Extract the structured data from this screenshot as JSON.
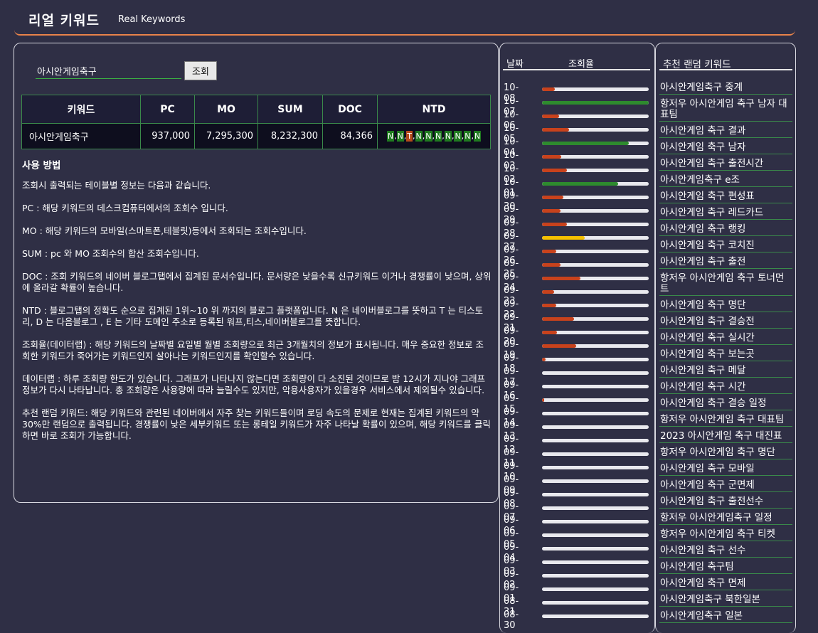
{
  "header": {
    "title": "리얼 키워드",
    "subtitle": "Real Keywords"
  },
  "search": {
    "value": "아시안게임축구",
    "button_label": "조회"
  },
  "table": {
    "headers": [
      "키워드",
      "PC",
      "MO",
      "SUM",
      "DOC",
      "NTD"
    ],
    "row": {
      "keyword": "아시안게임축구",
      "pc": "937,000",
      "mo": "7,295,300",
      "sum": "8,232,300",
      "doc": "84,366"
    },
    "ntd": [
      "N",
      "N",
      "T",
      "N",
      "N",
      "N",
      "N",
      "N",
      "N",
      "N"
    ]
  },
  "usage": {
    "title": "사용 방법",
    "paragraphs": [
      "조회시 출력되는 테이블별 정보는 다음과 같습니다.",
      "PC : 해당 키워드의 데스크컴퓨터에서의 조회수 입니다.",
      "MO : 해당 키워드의 모바일(스마트폰,테블릿)등에서 조회되는 조회수입니다.",
      "SUM : pc 와 MO 조회수의 합산 조회수입니다.",
      "DOC : 조회 키워드의 네이버 블로그탭에서 집계된 문서수입니다. 문서량은 낮을수록 신규키워드 이거나 경쟁률이 낮으며, 상위에 올라갈 확률이 높습니다.",
      "NTD : 블로그탭의 정확도 순으로 집계된 1위~10 위 까지의 블로그 플랫폼입니다. N 은 네이버블로그를 뜻하고 T 는 티스토리, D 는 다음블로그 , E 는 기타 도메인 주소로 등록된 워프,티스,네이버블로그를 뜻합니다.",
      "조회율(데이터랩) : 해당 키워드의 날짜별 요일별 월별 조회량으로 최근 3개월치의 정보가 표시됩니다. 매우 중요한 정보로 조회한 키워드가 죽어가는 키워드인지 살아나는 키워드인지를 확인할수 있습니다.",
      "데이터랩 : 하루 조회량 한도가 있습니다. 그래프가 나타나지 않는다면 조회량이 다 소진된 것이므로 밤 12시가 지나야 그래프 정보가 다시 나타납니다. 총 조회량은 사용량에 따라 늘릴수도 있지만, 악용사용자가 있을경우 서비스에서 제외될수 있습니다.",
      "추천 랜덤 키워드: 해당 키워드와 관련된 네이버에서 자주 찾는 키워드들이며 로딩 속도의 문제로 현재는 집계된 키워드의 약 30%만 랜덤으로 출력됩니다. 경쟁률이 낮은 세부키워드 또는 롱테일 키워드가 자주 나타날 확률이 있으며, 해당 키워드를 클릭하면 바로 조회가 가능합니다."
    ]
  },
  "trend": {
    "date_label": "날짜",
    "rate_label": "조회율",
    "colors": {
      "low": "#c8421c",
      "high": "#2e8b2e",
      "mid": "#f5c000",
      "track": "#e9e9ee"
    },
    "rows": [
      {
        "date": "10-08",
        "value": 12,
        "color": "low"
      },
      {
        "date": "10-07",
        "value": 100,
        "color": "high"
      },
      {
        "date": "10-06",
        "value": 16,
        "color": "low"
      },
      {
        "date": "10-05",
        "value": 25,
        "color": "low"
      },
      {
        "date": "10-04",
        "value": 81,
        "color": "high"
      },
      {
        "date": "10-03",
        "value": 18,
        "color": "low"
      },
      {
        "date": "10-02",
        "value": 23,
        "color": "low"
      },
      {
        "date": "10-01",
        "value": 71,
        "color": "high"
      },
      {
        "date": "09-30",
        "value": 20,
        "color": "low"
      },
      {
        "date": "09-29",
        "value": 17,
        "color": "low"
      },
      {
        "date": "09-28",
        "value": 23,
        "color": "low"
      },
      {
        "date": "09-27",
        "value": 40,
        "color": "mid"
      },
      {
        "date": "09-26",
        "value": 13,
        "color": "low"
      },
      {
        "date": "09-25",
        "value": 17,
        "color": "low"
      },
      {
        "date": "09-24",
        "value": 36,
        "color": "low"
      },
      {
        "date": "09-23",
        "value": 11,
        "color": "low"
      },
      {
        "date": "09-22",
        "value": 13,
        "color": "low"
      },
      {
        "date": "09-21",
        "value": 30,
        "color": "low"
      },
      {
        "date": "09-20",
        "value": 14,
        "color": "low"
      },
      {
        "date": "09-19",
        "value": 32,
        "color": "low"
      },
      {
        "date": "09-18",
        "value": 3,
        "color": "low"
      },
      {
        "date": "09-17",
        "value": 0,
        "color": "low"
      },
      {
        "date": "09-16",
        "value": 0,
        "color": "low"
      },
      {
        "date": "09-15",
        "value": 2,
        "color": "low"
      },
      {
        "date": "09-14",
        "value": 0,
        "color": "low"
      },
      {
        "date": "09-13",
        "value": 0,
        "color": "low"
      },
      {
        "date": "09-12",
        "value": 0,
        "color": "low"
      },
      {
        "date": "09-11",
        "value": 0,
        "color": "low"
      },
      {
        "date": "09-10",
        "value": 0,
        "color": "low"
      },
      {
        "date": "09-09",
        "value": 0,
        "color": "low"
      },
      {
        "date": "09-08",
        "value": 0,
        "color": "low"
      },
      {
        "date": "09-07",
        "value": 0,
        "color": "low"
      },
      {
        "date": "09-06",
        "value": 0,
        "color": "low"
      },
      {
        "date": "09-05",
        "value": 0,
        "color": "low"
      },
      {
        "date": "09-04",
        "value": 0,
        "color": "low"
      },
      {
        "date": "09-03",
        "value": 0,
        "color": "low"
      },
      {
        "date": "09-02",
        "value": 0,
        "color": "low"
      },
      {
        "date": "09-01",
        "value": 0,
        "color": "low"
      },
      {
        "date": "08-31",
        "value": 0,
        "color": "low"
      },
      {
        "date": "08-30",
        "value": 0,
        "color": "low"
      }
    ]
  },
  "recommended": {
    "title": "추천 랜덤 키워드",
    "items": [
      "아시안게임축구 중계",
      "항저우 아시안게임 축구 남자 대표팀",
      "아시안게임 축구 결과",
      "아시안게임 축구 남자",
      "아시안게임 축구 출전시간",
      "아시안게임축구 e조",
      "아시안게임 축구 편성표",
      "아시안게임 축구 레드카드",
      "아시안게임 축구 랭킹",
      "아시안게임 축구 코치진",
      "아시안게임 축구 출전",
      "항저우 아시안게임 축구 토너먼트",
      "아시안게임 축구 명단",
      "아시안게임 축구 결승전",
      "아시안게임 축구 실시간",
      "아시안게임 축구 보는곳",
      "아시안게임 축구 메달",
      "아시안게임 축구 시간",
      "아시안게임 축구 결승 일정",
      "항저우 아시안게임 축구 대표팀",
      "2023 아시안게임 축구 대진표",
      "항저우 아시안게임 축구 명단",
      "아시안게임 축구 모바일",
      "아시안게임 축구 군면제",
      "아시안게임 축구 출전선수",
      "항저우 아시안게임축구 일정",
      "항저우 아시안게임 축구 티켓",
      "아시안게임 축구 선수",
      "아시안게임 축구팀",
      "아시안게임 축구 면제",
      "아시안게임축구 북한일본",
      "아시안게임축구 일본"
    ]
  }
}
